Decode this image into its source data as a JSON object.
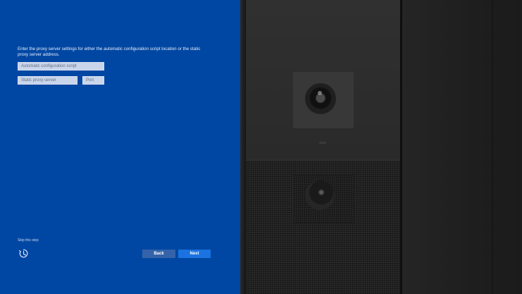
{
  "setup": {
    "instructions": "Enter the proxy server settings for either the automatic configuration script location or the static proxy server address.",
    "auto_config_placeholder": "Automatic configuration script",
    "static_proxy_placeholder": "Static proxy server",
    "port_placeholder": "Port",
    "skip_label": "Skip this step",
    "back_label": "Back",
    "next_label": "Next"
  },
  "colors": {
    "panel_bg": "#0047a3",
    "next_button": "#1a73e0",
    "back_button": "#3563a9"
  },
  "icons": {
    "accessibility": "accessibility-icon"
  }
}
